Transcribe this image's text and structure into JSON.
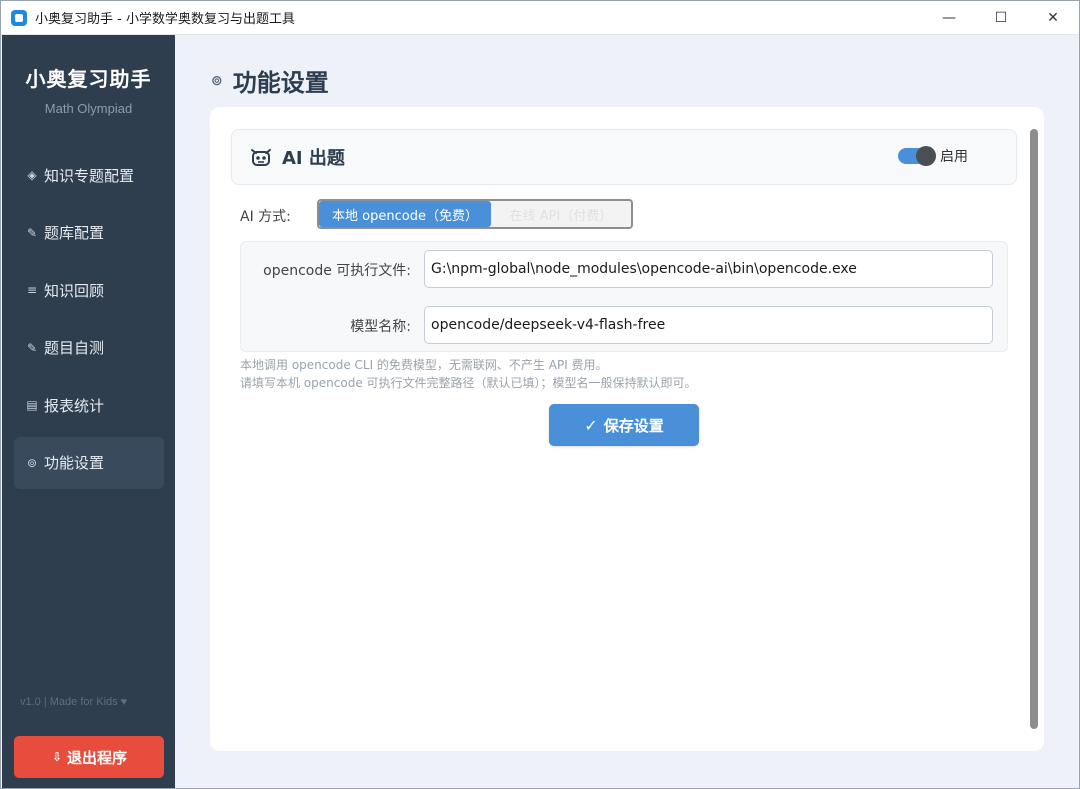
{
  "window": {
    "title": "小奥复习助手 - 小学数学奥数复习与出题工具",
    "minimize": "—",
    "maximize": "☐",
    "close": "✕"
  },
  "sidebar": {
    "brand_title": "小奥复习助手",
    "brand_subtitle": "Math Olympiad",
    "items": [
      {
        "icon": "◈",
        "label": "知识专题配置"
      },
      {
        "icon": "✎",
        "label": "题库配置"
      },
      {
        "icon": "≡",
        "label": "知识回顾"
      },
      {
        "icon": "✎",
        "label": "题目自测"
      },
      {
        "icon": "▤",
        "label": "报表统计"
      },
      {
        "icon": "⊚",
        "label": "功能设置"
      }
    ],
    "active_index": 5,
    "footer": "v1.0 | Made for Kids ♥",
    "exit_icon": "⇩",
    "exit_label": "退出程序"
  },
  "main": {
    "page_icon": "⊚",
    "page_title": "功能设置",
    "section": {
      "title": "AI 出题",
      "toggle_label": "启用",
      "toggle_on": true
    },
    "ai_mode": {
      "label": "AI 方式:",
      "selected": "本地 opencode（免费）",
      "other": "在线 API（付费）"
    },
    "fields": [
      {
        "label": "opencode 可执行文件:",
        "value": "G:\\npm-global\\node_modules\\opencode-ai\\bin\\opencode.exe"
      },
      {
        "label": "模型名称:",
        "value": "opencode/deepseek-v4-flash-free"
      }
    ],
    "hints": [
      "本地调用 opencode CLI 的免费模型，无需联网、不产生 API 费用。",
      "请填写本机 opencode 可执行文件完整路径（默认已填）；模型名一般保持默认即可。"
    ],
    "save_icon": "✓",
    "save_label": "保存设置"
  },
  "colors": {
    "sidebar_bg": "#2f3e4e",
    "accent": "#4a90d9",
    "danger": "#e74c3c"
  }
}
